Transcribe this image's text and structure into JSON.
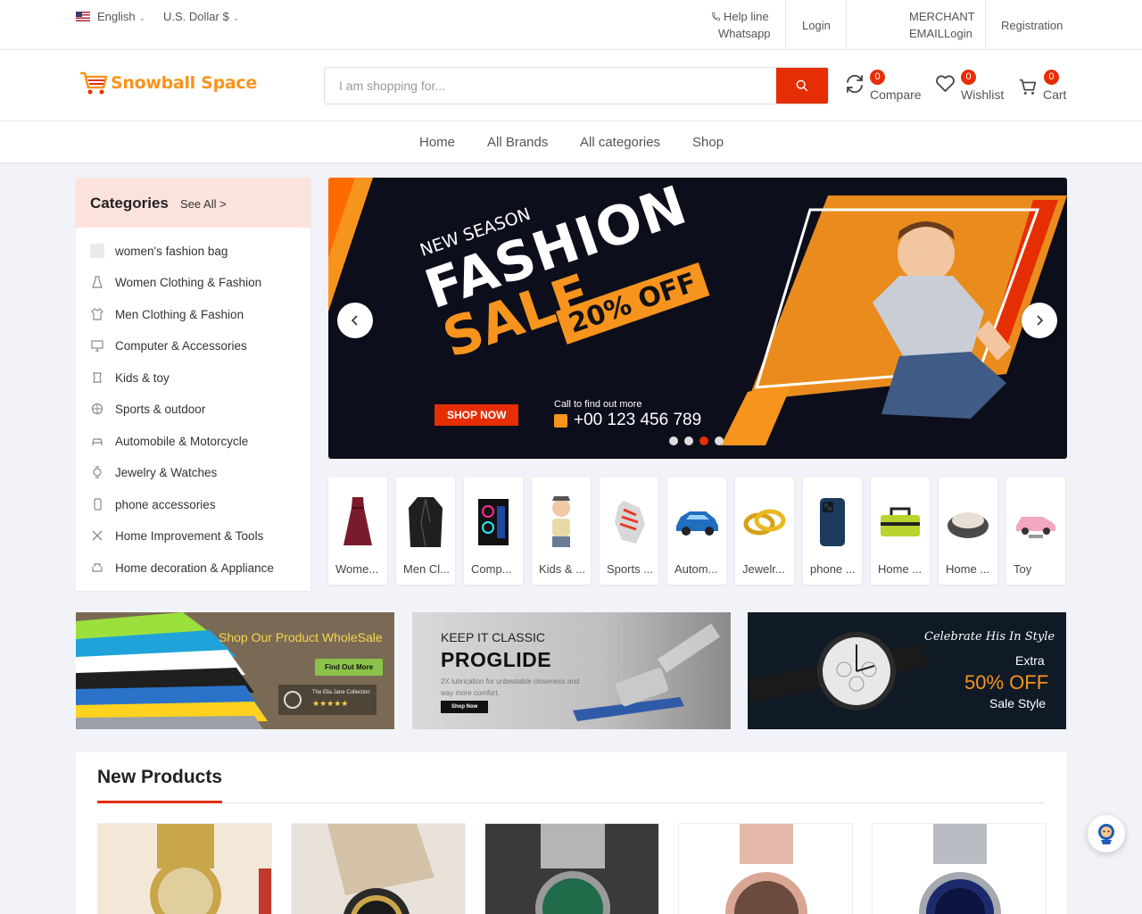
{
  "topbar": {
    "language": "English",
    "currency": "U.S. Dollar $",
    "help_line": "Help line",
    "whatsapp": "Whatsapp",
    "login": "Login",
    "merchant": "MERCHANT",
    "email_login": "EMAILLogin",
    "registration": "Registration"
  },
  "header": {
    "logo_text": "Snowball Space",
    "search_placeholder": "I am shopping for...",
    "compare_label": "Compare",
    "compare_count": "0",
    "wishlist_label": "Wishlist",
    "wishlist_count": "0",
    "cart_label": "Cart",
    "cart_count": "0"
  },
  "nav": [
    "Home",
    "All Brands",
    "All categories",
    "Shop"
  ],
  "categories": {
    "title": "Categories",
    "see_all": "See All >",
    "items": [
      "women's fashion bag",
      "Women Clothing & Fashion",
      "Men Clothing & Fashion",
      "Computer & Accessories",
      "Kids & toy",
      "Sports & outdoor",
      "Automobile & Motorcycle",
      "Jewelry & Watches",
      "phone accessories",
      "Home Improvement & Tools",
      "Home decoration & Appliance"
    ]
  },
  "banner": {
    "new_season": "NEW SEASON",
    "fashion": "FASHION",
    "sale": "SALE",
    "offer": "20% OFF",
    "shop_now": "SHOP NOW",
    "call_text": "Call to find out more",
    "phone": "+00 123 456 789",
    "slide_count": 4,
    "active_slide": 3
  },
  "category_strip": [
    "Wome...",
    "Men Cl...",
    "Comp...",
    "Kids & ...",
    "Sports ...",
    "Autom...",
    "Jewelr...",
    "phone ...",
    "Home ...",
    "Home ...",
    "Toy"
  ],
  "promos": {
    "p1_title": "Shop Our Product WholeSale",
    "p1_btn": "Find Out More",
    "p1_brand": "The Ella Jane Collection",
    "p2_kicker": "KEEP IT CLASSIC",
    "p2_title": "PROGLIDE",
    "p2_desc": "2X lubrication for unbeatable closeness and way more comfort.",
    "p2_btn": "Shop Now",
    "p3_script": "Celebrate His In Style",
    "p3_extra": "Extra",
    "p3_off": "50% OFF",
    "p3_sale": "Sale Style"
  },
  "new_products": {
    "title": "New Products"
  },
  "colors": {
    "accent": "#e62e04",
    "brand_orange": "#f7941d",
    "banner_bg": "#0d0e1c"
  }
}
